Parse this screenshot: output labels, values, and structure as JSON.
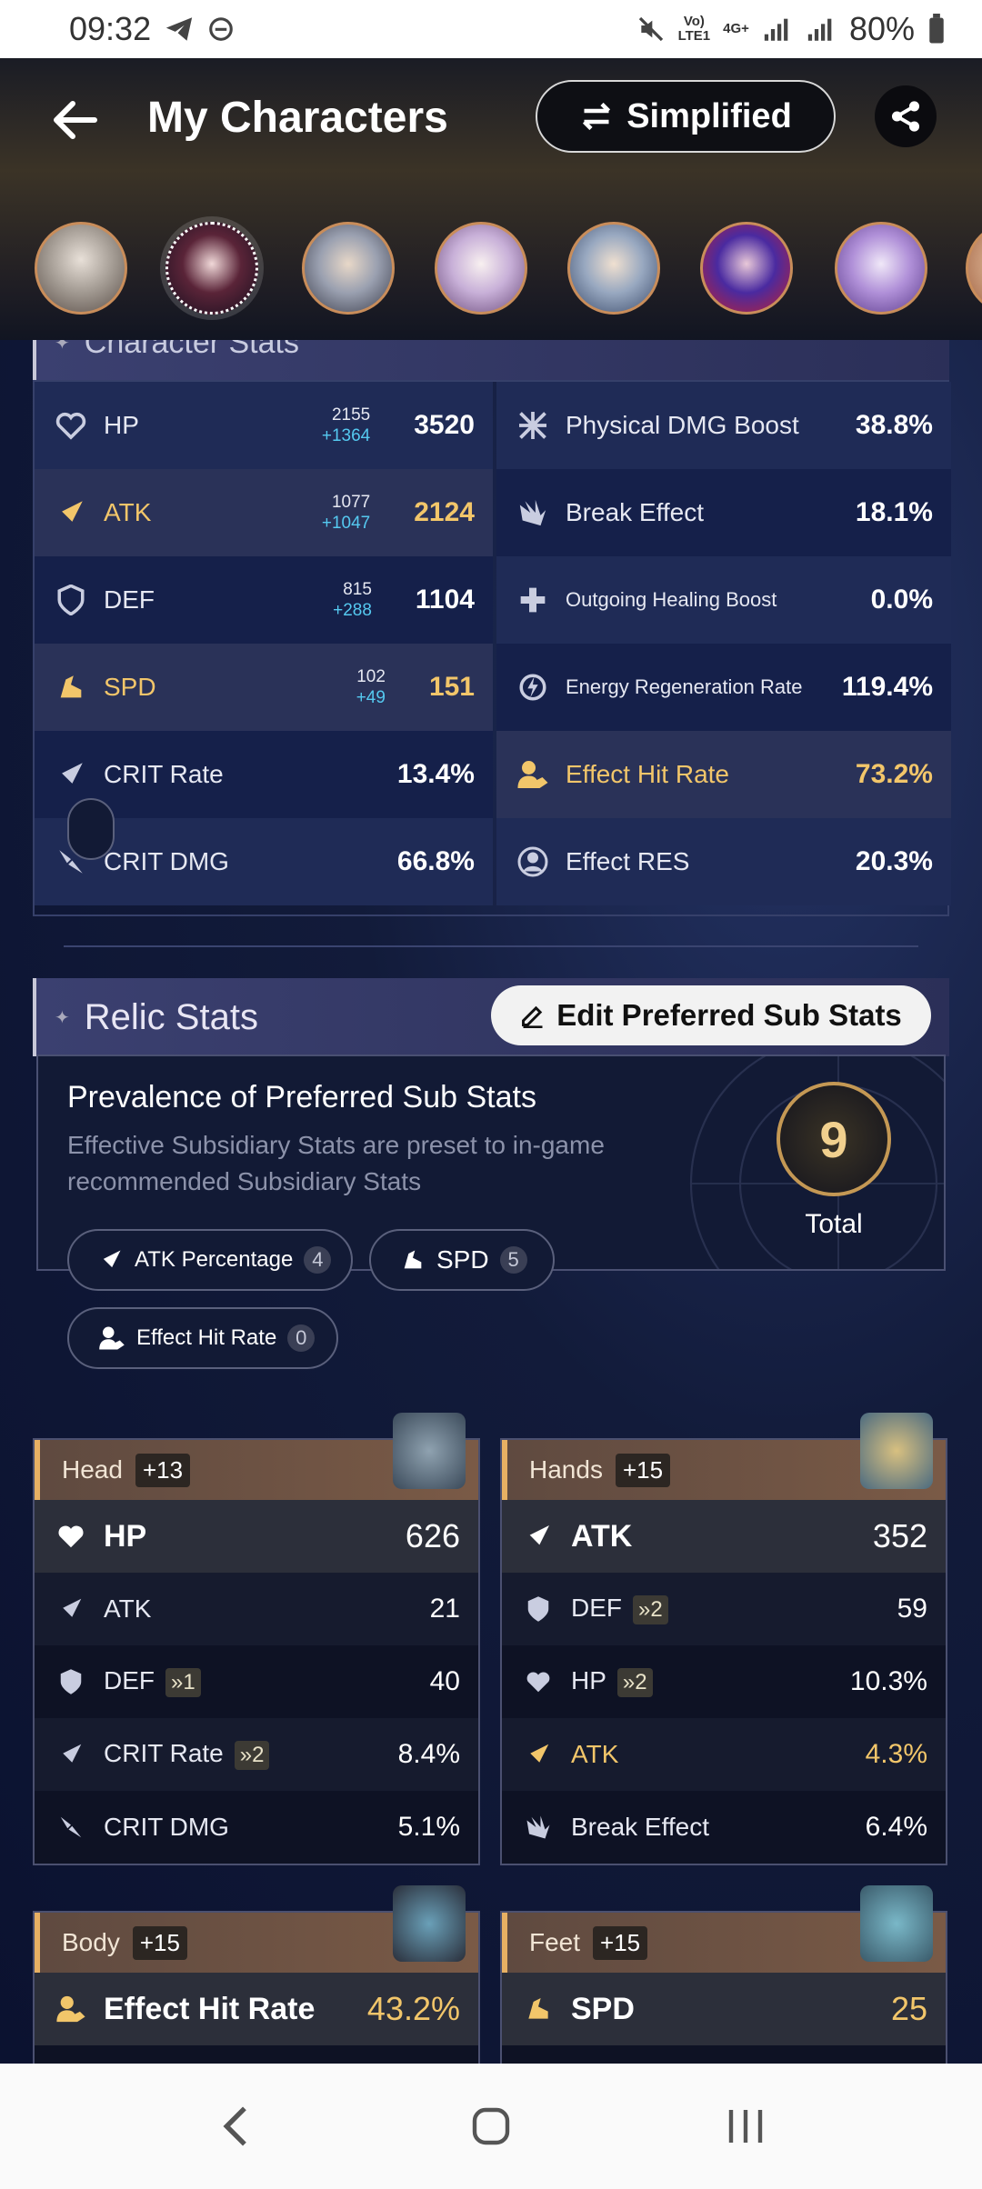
{
  "status_bar": {
    "time": "09:32",
    "network_top": "Vo)",
    "network_bottom": "LTE1",
    "net4g": "4G+",
    "battery": "80%"
  },
  "header": {
    "title": "My Characters",
    "simplified_label": "Simplified"
  },
  "character_stats": {
    "title": "Character Stats",
    "left": [
      {
        "name": "HP",
        "base": "2155",
        "bonus": "+1364",
        "value": "3520"
      },
      {
        "name": "ATK",
        "base": "1077",
        "bonus": "+1047",
        "value": "2124"
      },
      {
        "name": "DEF",
        "base": "815",
        "bonus": "+288",
        "value": "1104"
      },
      {
        "name": "SPD",
        "base": "102",
        "bonus": "+49",
        "value": "151"
      },
      {
        "name": "CRIT Rate",
        "value": "13.4%"
      },
      {
        "name": "CRIT DMG",
        "value": "66.8%"
      }
    ],
    "right": [
      {
        "name": "Physical DMG Boost",
        "value": "38.8%"
      },
      {
        "name": "Break Effect",
        "value": "18.1%"
      },
      {
        "name": "Outgoing Healing Boost",
        "value": "0.0%"
      },
      {
        "name": "Energy Regeneration Rate",
        "value": "119.4%"
      },
      {
        "name": "Effect Hit Rate",
        "value": "73.2%"
      },
      {
        "name": "Effect RES",
        "value": "20.3%"
      }
    ]
  },
  "relic_stats": {
    "title": "Relic Stats",
    "edit_label": "Edit Preferred Sub Stats",
    "prevalence_title": "Prevalence of Preferred Sub Stats",
    "prevalence_desc": "Effective Subsidiary Stats are preset to in-game recommended Subsidiary Stats",
    "total_value": "9",
    "total_label": "Total",
    "chips": [
      {
        "label": "ATK Percentage",
        "count": "4"
      },
      {
        "label": "SPD",
        "count": "5"
      },
      {
        "label": "Effect Hit Rate",
        "count": "0"
      }
    ]
  },
  "relics": {
    "head": {
      "slot": "Head",
      "level": "+13",
      "main": {
        "name": "HP",
        "value": "626"
      },
      "subs": [
        {
          "name": "ATK",
          "value": "21"
        },
        {
          "name": "DEF",
          "roll": "»1",
          "value": "40"
        },
        {
          "name": "CRIT Rate",
          "roll": "»2",
          "value": "8.4%"
        },
        {
          "name": "CRIT DMG",
          "value": "5.1%"
        }
      ]
    },
    "hands": {
      "slot": "Hands",
      "level": "+15",
      "main": {
        "name": "ATK",
        "value": "352"
      },
      "subs": [
        {
          "name": "DEF",
          "roll": "»2",
          "value": "59"
        },
        {
          "name": "HP",
          "roll": "»2",
          "value": "10.3%"
        },
        {
          "name": "ATK",
          "value": "4.3%"
        },
        {
          "name": "Break Effect",
          "value": "6.4%"
        }
      ]
    },
    "body": {
      "slot": "Body",
      "level": "+15",
      "main": {
        "name": "Effect Hit Rate",
        "value": "43.2%"
      }
    },
    "feet": {
      "slot": "Feet",
      "level": "+15",
      "main": {
        "name": "SPD",
        "value": "25"
      }
    }
  },
  "colors": {
    "accent_gold": "#f2c66a",
    "bonus_cyan": "#55c9f0",
    "panel_dark": "#15204a",
    "panel_light": "#1f2b56"
  }
}
